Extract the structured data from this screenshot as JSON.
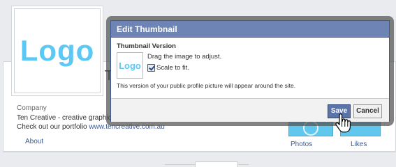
{
  "page": {
    "logo_text": "Logo",
    "name_peek": "T",
    "about_label": "Company",
    "about_line1": "Ten Creative - creative graphic, w",
    "about_line2_prefix": "Check out our portfolio ",
    "about_link": "www.tencreative.com.au",
    "nav_about": "About",
    "nav_photos": "Photos",
    "nav_likes": "Likes"
  },
  "dialog": {
    "title": "Edit Thumbnail",
    "section_title": "Thumbnail Version",
    "thumb_text": "Logo",
    "drag_hint": "Drag the image to adjust.",
    "scale_label": "Scale to fit.",
    "scale_checked": true,
    "version_note": "This version of your public profile picture will appear around the site.",
    "save_label": "Save",
    "cancel_label": "Cancel"
  },
  "colors": {
    "accent": "#3b5998",
    "header": "#6d84b4",
    "logo": "#5cc8f5"
  },
  "icons": {
    "cursor": "hand-pointer-icon",
    "checkbox": "checkmark-icon"
  }
}
